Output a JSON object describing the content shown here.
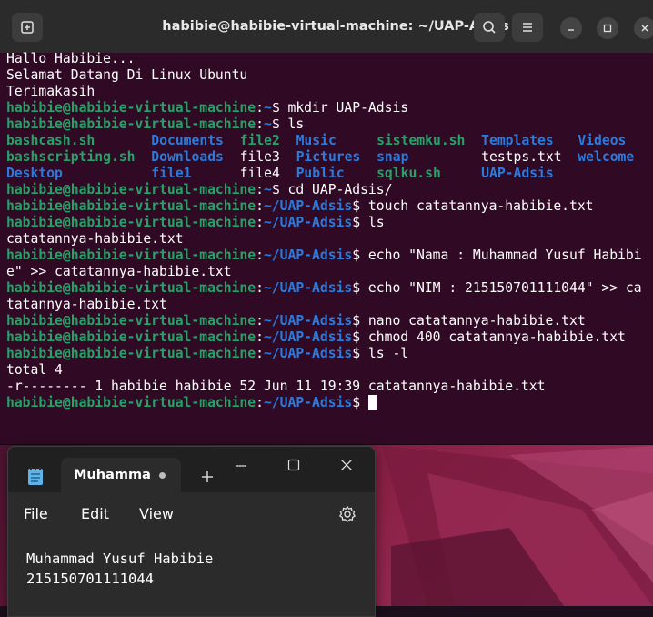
{
  "terminal": {
    "title": "habibie@habibie-virtual-machine: ~/UAP-Adsis",
    "lines": [
      {
        "out": "Hallo Habibie..."
      },
      {
        "out": "Selamat Datang Di Linux Ubuntu"
      },
      {
        "out": "Terimakasih"
      },
      {
        "user": "habibie@habibie-virtual-machine",
        "sep": ":",
        "dir": "~",
        "cmd": "$ mkdir UAP-Adsis"
      },
      {
        "user": "habibie@habibie-virtual-machine",
        "sep": ":",
        "dir": "~",
        "cmd": "$ ls"
      }
    ],
    "ls_rows": [
      [
        {
          "text": "bashcash.sh",
          "color": "green"
        },
        {
          "text": "Documents",
          "color": "blue"
        },
        {
          "text": "file2",
          "color": "green"
        },
        {
          "text": "Music",
          "color": "blue"
        },
        {
          "text": "sistemku.sh",
          "color": "green"
        },
        {
          "text": "Templates",
          "color": "blue"
        },
        {
          "text": "Videos",
          "color": "blue"
        }
      ],
      [
        {
          "text": "bashscripting.sh",
          "color": "green"
        },
        {
          "text": "Downloads",
          "color": "blue"
        },
        {
          "text": "file3",
          "color": "white"
        },
        {
          "text": "Pictures",
          "color": "blue"
        },
        {
          "text": "snap",
          "color": "blue"
        },
        {
          "text": "testps.txt",
          "color": "white"
        },
        {
          "text": "welcome",
          "color": "blue"
        }
      ],
      [
        {
          "text": "Desktop",
          "color": "blue"
        },
        {
          "text": "file1",
          "color": "blue"
        },
        {
          "text": "file4",
          "color": "white"
        },
        {
          "text": "Public",
          "color": "blue"
        },
        {
          "text": "sqlku.sh",
          "color": "green"
        },
        {
          "text": "UAP-Adsis",
          "color": "blue"
        }
      ]
    ],
    "lines2": [
      {
        "user": "habibie@habibie-virtual-machine",
        "sep": ":",
        "dir": "~",
        "cmd": "$ cd UAP-Adsis/"
      },
      {
        "user": "habibie@habibie-virtual-machine",
        "sep": ":",
        "dir": "~/UAP-Adsis",
        "cmd": "$ touch catatannya-habibie.txt"
      },
      {
        "user": "habibie@habibie-virtual-machine",
        "sep": ":",
        "dir": "~/UAP-Adsis",
        "cmd": "$ ls"
      },
      {
        "out": "catatannya-habibie.txt"
      },
      {
        "user": "habibie@habibie-virtual-machine",
        "sep": ":",
        "dir": "~/UAP-Adsis",
        "cmd": "$ echo \"Nama : Muhammad Yusuf Habibi"
      },
      {
        "out": "e\" >> catatannya-habibie.txt"
      },
      {
        "user": "habibie@habibie-virtual-machine",
        "sep": ":",
        "dir": "~/UAP-Adsis",
        "cmd": "$ echo \"NIM : 215150701111044\" >> ca"
      },
      {
        "out": "tatannya-habibie.txt"
      },
      {
        "user": "habibie@habibie-virtual-machine",
        "sep": ":",
        "dir": "~/UAP-Adsis",
        "cmd": "$ nano catatannya-habibie.txt"
      },
      {
        "user": "habibie@habibie-virtual-machine",
        "sep": ":",
        "dir": "~/UAP-Adsis",
        "cmd": "$ chmod 400 catatannya-habibie.txt"
      },
      {
        "user": "habibie@habibie-virtual-machine",
        "sep": ":",
        "dir": "~/UAP-Adsis",
        "cmd": "$ ls -l"
      },
      {
        "out": "total 4"
      },
      {
        "out": "-r-------- 1 habibie habibie 52 Jun 11 19:39 catatannya-habibie.txt"
      },
      {
        "user": "habibie@habibie-virtual-machine",
        "sep": ":",
        "dir": "~/UAP-Adsis",
        "cmd": "$ ",
        "cursor": true
      }
    ],
    "colors": {
      "prompt": "#26a269",
      "dir": "#2a7bde",
      "background": "#300a24"
    }
  },
  "notepad": {
    "tab_label": "Muhamma",
    "menu": {
      "file": "File",
      "edit": "Edit",
      "view": "View"
    },
    "content": [
      "Muhammad Yusuf Habibie",
      "215150701111044"
    ]
  }
}
